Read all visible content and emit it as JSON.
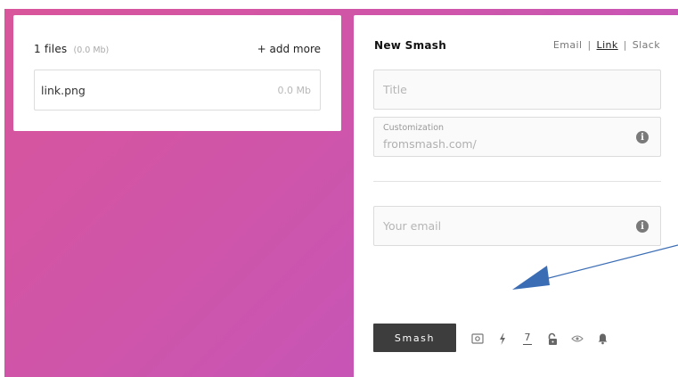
{
  "files": {
    "count_label": "1 files",
    "total_size": "(0.0 Mb)",
    "add_more": "+ add more",
    "items": [
      {
        "name": "link.png",
        "size": "0.0 Mb"
      }
    ]
  },
  "smash": {
    "title": "New Smash",
    "tabs": [
      {
        "label": "Email",
        "active": false
      },
      {
        "label": "Link",
        "active": true
      },
      {
        "label": "Slack",
        "active": false
      }
    ],
    "separator": "|",
    "title_field": {
      "placeholder": "Title",
      "value": ""
    },
    "customization": {
      "label": "Customization",
      "value": "fromsmash.com/"
    },
    "email_field": {
      "placeholder": "Your email",
      "value": ""
    },
    "info_glyph": "i",
    "button_label": "Smash",
    "days_value": "7",
    "icons": [
      "camera-icon",
      "lightning-icon",
      "days-counter",
      "unlock-icon",
      "eye-icon",
      "bell-icon"
    ]
  },
  "colors": {
    "gradient_start": "#d9559b",
    "gradient_end": "#bf55c6",
    "button_bg": "#3d3d3d",
    "arrow": "#3b6db5"
  }
}
